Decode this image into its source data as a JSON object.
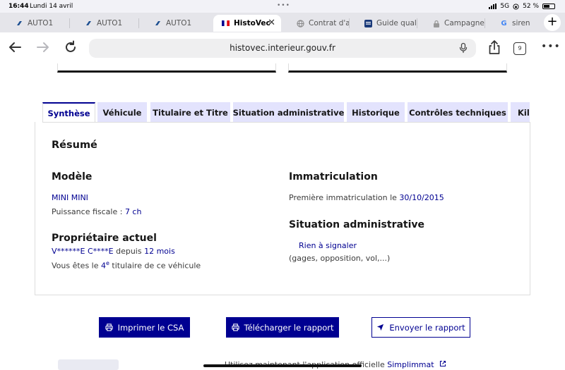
{
  "status_bar": {
    "time": "16:44",
    "date": "Lundi 14 avril",
    "network": "5G",
    "battery": "52 %"
  },
  "browser_tabs": [
    {
      "label": "AUTO1",
      "icon": "auto1-icon"
    },
    {
      "label": "AUTO1",
      "icon": "auto1-icon"
    },
    {
      "label": "AUTO1",
      "icon": "auto1-icon"
    },
    {
      "label": "HistoVec",
      "icon": "french-flag-icon",
      "active": true
    },
    {
      "label": "Contrat d'ac",
      "icon": "globe-icon"
    },
    {
      "label": "Guide qualit",
      "icon": "grid-icon"
    },
    {
      "label": "Campagne d",
      "icon": "lock-icon"
    },
    {
      "label": "siren",
      "icon": "google-icon"
    }
  ],
  "address_bar": {
    "url": "histovec.interieur.gouv.fr",
    "tab_count": "9"
  },
  "page_tabs": [
    {
      "label": "Synthèse",
      "active": true
    },
    {
      "label": "Véhicule"
    },
    {
      "label": "Titulaire et Titre"
    },
    {
      "label": "Situation administrative"
    },
    {
      "label": "Historique"
    },
    {
      "label": "Contrôles techniques"
    },
    {
      "label": "Kilo"
    }
  ],
  "summary": {
    "title": "Résumé",
    "model": {
      "heading": "Modèle",
      "name": "MINI MINI",
      "power_label": "Puissance fiscale : ",
      "power_value": "7 ch"
    },
    "owner": {
      "heading": "Propriétaire actuel",
      "name": "V******E C****E",
      "since_label": " depuis ",
      "since_value": "12 mois",
      "holder_prefix": "Vous êtes le ",
      "holder_number": "4",
      "holder_sup": "e",
      "holder_suffix": " titulaire de ce véhicule"
    },
    "registration": {
      "heading": "Immatriculation",
      "first_label": "Première immatriculation le ",
      "first_date": "30/10/2015"
    },
    "admin": {
      "heading": "Situation administrative",
      "status": "Rien à signaler",
      "details": "(gages, opposition, vol,...)"
    }
  },
  "buttons": {
    "print": "Imprimer le CSA",
    "download": "Télécharger le rapport",
    "send": "Envoyer le rapport"
  },
  "footer": {
    "text": "Utilisez maintenant l'application officielle ",
    "link": "Simplimmat"
  },
  "colors": {
    "primary": "#000091",
    "tab_bg": "#e3e3fd"
  }
}
